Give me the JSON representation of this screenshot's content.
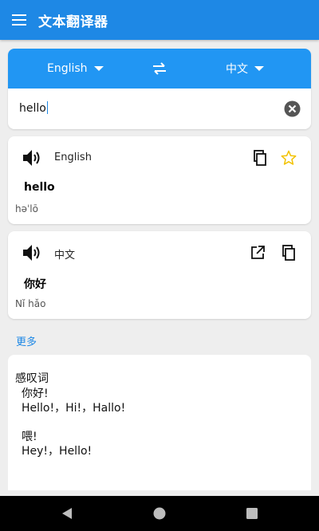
{
  "app_bar": {
    "title": "文本翻译器",
    "color": "#1e88e5"
  },
  "languages": {
    "source": "English",
    "target": "中文",
    "swap_icon": "swap-horizontal-icon",
    "bar_color": "#2196f3"
  },
  "input": {
    "value": "hello",
    "clear_icon": "clear-circle-icon"
  },
  "source_card": {
    "language": "English",
    "text": "hello",
    "phonetic": "həˈlō",
    "icons": [
      "speaker-icon",
      "copy-icon",
      "star-icon"
    ]
  },
  "target_card": {
    "language": "中文",
    "text": "你好",
    "phonetic": "Nǐ hǎo",
    "icons": [
      "speaker-icon",
      "open-external-icon",
      "copy-icon"
    ]
  },
  "more": {
    "label": "更多",
    "part_of_speech": "感叹词",
    "entries": [
      {
        "word": "你好!",
        "translations": "Hello!，Hi!，Hallo!"
      },
      {
        "word": "喂!",
        "translations": "Hey!，Hello!"
      }
    ]
  },
  "nav": {
    "icons": [
      "back-icon",
      "home-icon",
      "recents-icon"
    ]
  }
}
